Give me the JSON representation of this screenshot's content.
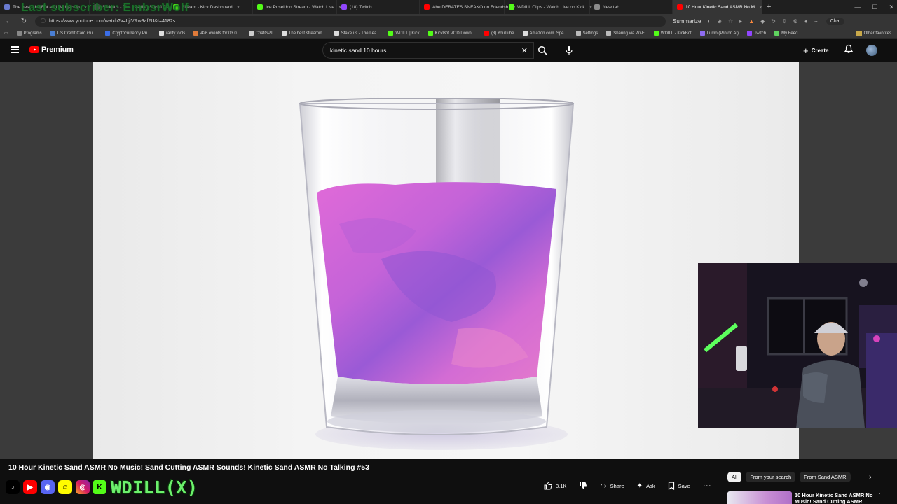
{
  "browser": {
    "overlay_text": "Last subscriber: EmbsrWolf",
    "tabs": [
      {
        "title": "The best ChatBot and Widgets fo",
        "color": "#6a7bd0"
      },
      {
        "title": "Stakeus - The Leading Social Ca",
        "color": "#5e5e5e"
      },
      {
        "title": "Stream - Kick Dashboard",
        "color": "#53fc18"
      },
      {
        "title": "Ice Poseidon Stream - Watch Live",
        "color": "#53fc18"
      },
      {
        "title": "(18) Twitch",
        "color": "#9146ff"
      },
      {
        "title": "Abe DEBATES SNEAKO on Friendsh",
        "color": "#ff0000"
      },
      {
        "title": "WDILL Clips - Watch Live on Kick",
        "color": "#53fc18"
      },
      {
        "title": "New tab",
        "color": "#8a8a8a"
      },
      {
        "title": "10 Hour Kinetic Sand ASMR No M",
        "color": "#ff0000"
      }
    ],
    "url": "https://www.youtube.com/watch?v=LjtVRw9af2U&t=4182s",
    "summarize_label": "Summarize",
    "chat_label": "Chat",
    "bookmarks": [
      {
        "label": "Programs",
        "color": "#888"
      },
      {
        "label": "US Credit Card Gui...",
        "color": "#4a7fd4"
      },
      {
        "label": "Cryptocurrency Pri...",
        "color": "#3b6ee8"
      },
      {
        "label": "rarity.tools",
        "color": "#ddd"
      },
      {
        "label": "426 events for 03.0...",
        "color": "#e07b3a"
      },
      {
        "label": "ChatGPT",
        "color": "#ccc"
      },
      {
        "label": "The best streamin...",
        "color": "#ddd"
      },
      {
        "label": "Stake.us - The Lea...",
        "color": "#ddd"
      },
      {
        "label": "WDILL | Kick",
        "color": "#53fc18"
      },
      {
        "label": "KickBot VOD Downl...",
        "color": "#53fc18"
      },
      {
        "label": "(3) YouTube",
        "color": "#ff0000"
      },
      {
        "label": "Amazon.com. Spe...",
        "color": "#ddd"
      },
      {
        "label": "Settings",
        "color": "#bbb"
      },
      {
        "label": "Sharing via Wi-Fi",
        "color": "#bbb"
      },
      {
        "label": "WDILL - KickBot",
        "color": "#53fc18"
      },
      {
        "label": "Lumo (Proton AI)",
        "color": "#8e6cf0"
      },
      {
        "label": "Twitch",
        "color": "#9146ff"
      },
      {
        "label": "My Feed",
        "color": "#5fd35f"
      }
    ],
    "other_favorites": "Other favorites"
  },
  "youtube": {
    "logo_text": "Premium",
    "search_value": "kinetic sand 10 hours",
    "create_label": "Create",
    "video_title": "10 Hour Kinetic Sand ASMR No Music! Sand Cutting ASMR Sounds! Kinetic Sand ASMR No Talking #53",
    "like_count": "3.1K",
    "share_label": "Share",
    "ask_label": "Ask",
    "save_label": "Save",
    "chips": [
      "All",
      "From your search",
      "From Sand ASMR"
    ],
    "rec_title": "10 Hour Kinetic Sand ASMR No Music! Sand Cutting ASMR"
  },
  "stream_overlay": {
    "handle": "WDILL(X)"
  },
  "colors": {
    "accent_red": "#ff0000",
    "kick_green": "#53fc18",
    "sand_pink": "#d86ad6",
    "sand_purple": "#8e5ad6"
  }
}
